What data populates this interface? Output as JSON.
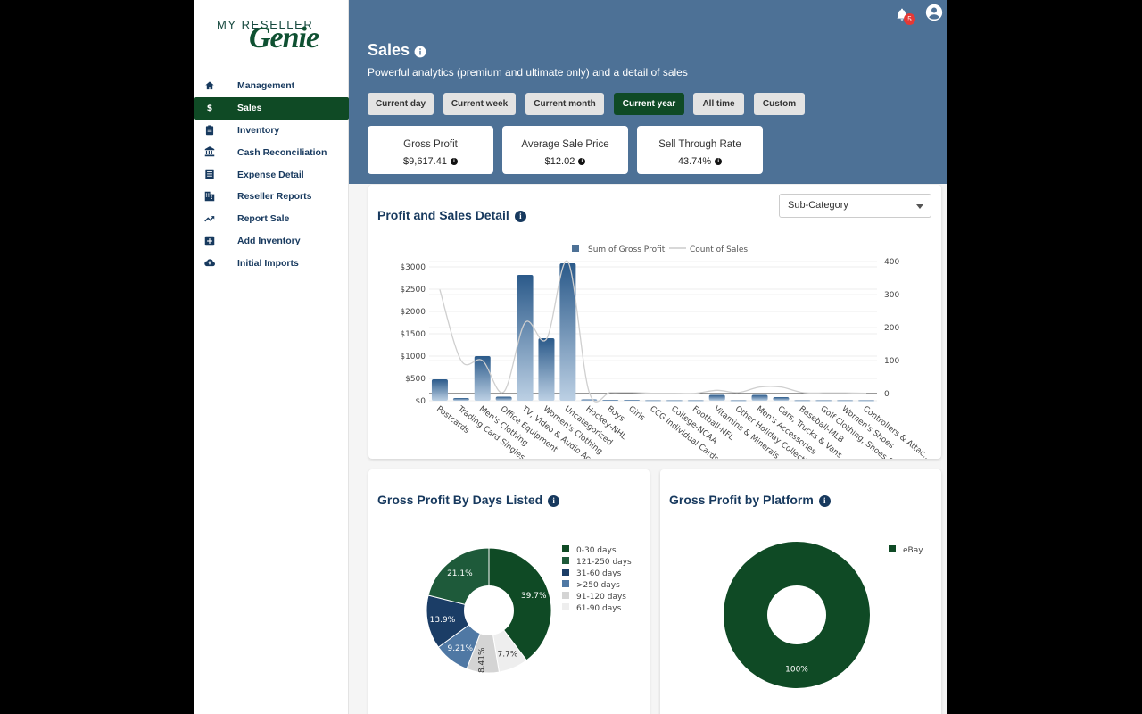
{
  "logo": {
    "line1": "MY RESELLER",
    "line2": "Genie"
  },
  "sidebar": {
    "items": [
      {
        "label": "Management",
        "icon": "home-icon"
      },
      {
        "label": "Sales",
        "icon": "dollar-icon"
      },
      {
        "label": "Inventory",
        "icon": "clipboard-icon"
      },
      {
        "label": "Cash Reconciliation",
        "icon": "bank-icon"
      },
      {
        "label": "Expense Detail",
        "icon": "list-icon"
      },
      {
        "label": "Reseller Reports",
        "icon": "building-icon"
      },
      {
        "label": "Report Sale",
        "icon": "trending-up-icon"
      },
      {
        "label": "Add Inventory",
        "icon": "plus-box-icon"
      },
      {
        "label": "Initial Imports",
        "icon": "cloud-upload-icon"
      }
    ],
    "active_index": 1
  },
  "header": {
    "notifications_count": "5",
    "title": "Sales",
    "subtitle": "Powerful analytics (premium and ultimate only) and a detail of sales",
    "ranges": [
      "Current day",
      "Current week",
      "Current month",
      "Current year",
      "All time",
      "Custom"
    ],
    "active_range": "Current year"
  },
  "kpis": [
    {
      "label": "Gross Profit",
      "value": "$9,617.41"
    },
    {
      "label": "Average Sale Price",
      "value": "$12.02"
    },
    {
      "label": "Sell Through Rate",
      "value": "43.74%"
    }
  ],
  "profit_card": {
    "title": "Profit and Sales Detail",
    "select_value": "Sub-Category"
  },
  "days_card": {
    "title": "Gross Profit By Days Listed"
  },
  "platform_card": {
    "title": "Gross Profit by Platform"
  },
  "chart_data": [
    {
      "type": "bar",
      "title": "Profit and Sales Detail",
      "legend": [
        "Sum of Gross Profit",
        "Count of Sales"
      ],
      "legend_position": "top",
      "categories": [
        "Postcards",
        "Trading Card Singles",
        "Men's Clothing",
        "Office Equipment",
        "TV, Video & Audio Acce...",
        "Women's Clothing",
        "Uncategorized",
        "Hockey-NHL",
        "Boys",
        "Girls",
        "CCG Individual Cards",
        "College-NCAA",
        "Football-NFL",
        "Vitamins & Minerals",
        "Other Holiday Collecti...",
        "Men's Accessories",
        "Cars, Trucks & Vans",
        "Baseball-MLB",
        "Golf Clothing, Shoes &...",
        "Women's Shoes",
        "Controllers & Attac..."
      ],
      "series": [
        {
          "name": "Sum of Gross Profit",
          "axis": "left",
          "values": [
            480,
            60,
            1000,
            90,
            2820,
            1400,
            3080,
            30,
            20,
            20,
            10,
            10,
            10,
            130,
            10,
            130,
            80,
            10,
            10,
            10,
            10
          ]
        },
        {
          "name": "Count of Sales",
          "axis": "right",
          "values": [
            315,
            100,
            100,
            5,
            215,
            165,
            400,
            5,
            3,
            3,
            1,
            1,
            1,
            10,
            3,
            20,
            20,
            3,
            2,
            2,
            1
          ]
        }
      ],
      "y_left": {
        "ticks": [
          "$0",
          "$500",
          "$1000",
          "$1500",
          "$2000",
          "$2500",
          "$3000"
        ],
        "range": [
          0,
          3000
        ]
      },
      "y_right": {
        "ticks": [
          "0",
          "100",
          "200",
          "300",
          "400"
        ],
        "range": [
          0,
          400
        ]
      }
    },
    {
      "type": "pie",
      "title": "Gross Profit By Days Listed",
      "labels": [
        "0-30 days",
        "121-250 days",
        "31-60 days",
        ">250 days",
        "91-120 days",
        "61-90 days"
      ],
      "colors": [
        "#0f4a25",
        "#1e5a3a",
        "#1b3d66",
        "#4f78a4",
        "#d4d4d4",
        "#eeeeee"
      ],
      "slice_order": [
        "0-30 days",
        "61-90 days",
        "91-120 days",
        ">250 days",
        "31-60 days",
        "121-250 days"
      ],
      "values": [
        39.7,
        7.7,
        8.41,
        9.21,
        13.9,
        21.1
      ],
      "slice_labels": [
        "39.7%",
        "7.7%",
        "8.41%",
        "9.21%",
        "13.9%",
        "21.1%"
      ]
    },
    {
      "type": "pie",
      "title": "Gross Profit by Platform",
      "labels": [
        "eBay"
      ],
      "colors": [
        "#0f4a25"
      ],
      "values": [
        100
      ],
      "slice_labels": [
        "100%"
      ]
    }
  ]
}
